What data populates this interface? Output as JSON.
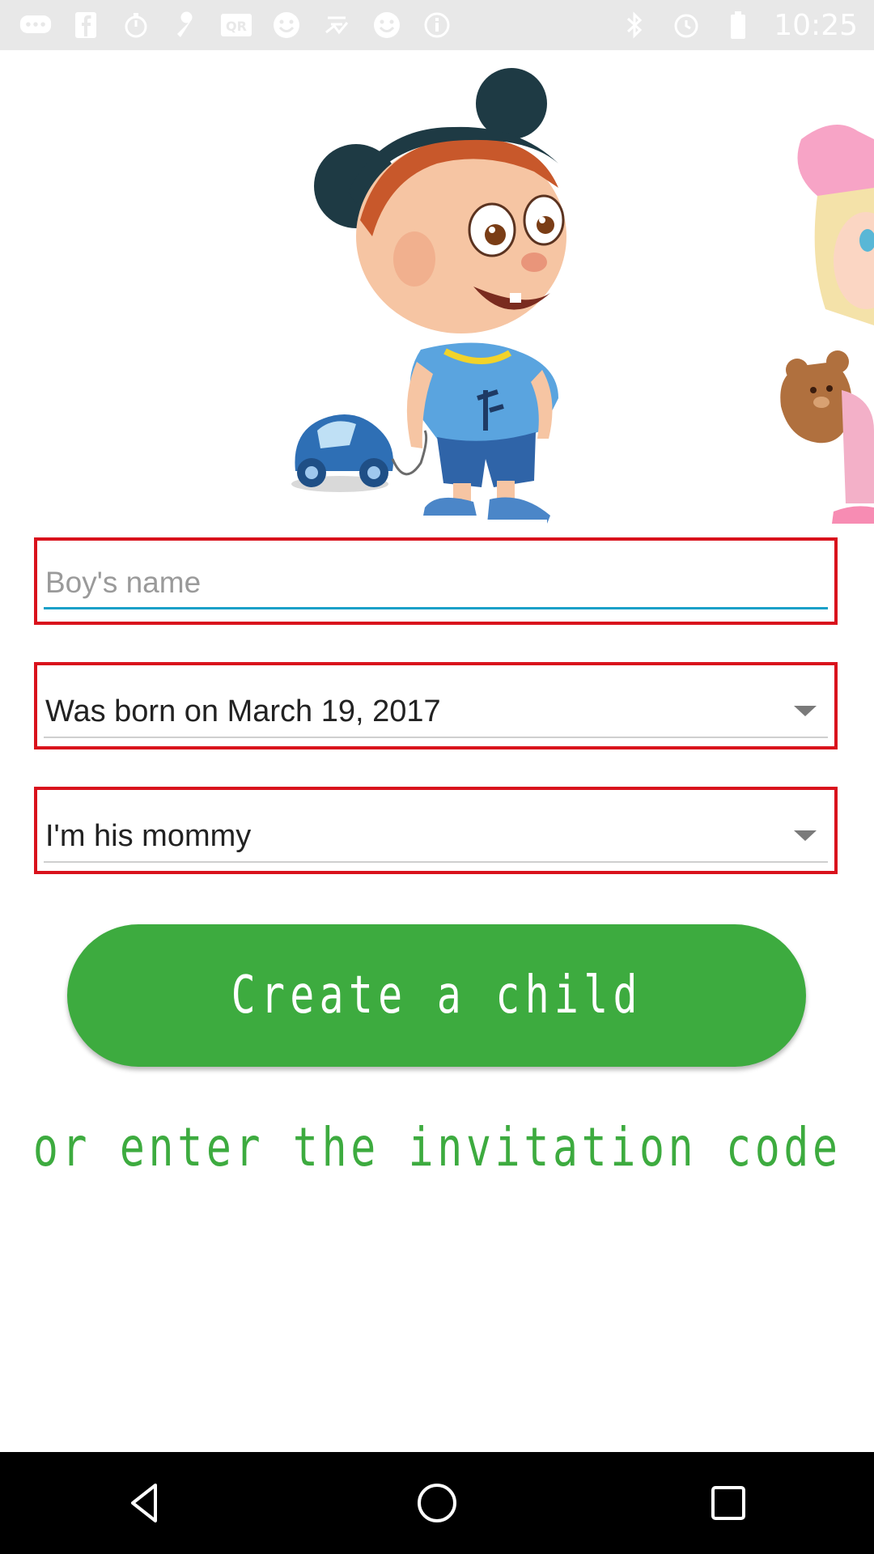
{
  "status_bar": {
    "time": "10:25",
    "left_icons": [
      "chat-icon",
      "facebook-icon",
      "timer-icon",
      "wrench-icon",
      "qr-icon",
      "smiley-icon",
      "app-icon",
      "smiley-icon",
      "info-icon"
    ],
    "right_icons": [
      "bluetooth-icon",
      "alarm-icon",
      "battery-icon"
    ]
  },
  "form": {
    "name_placeholder": "Boy's name",
    "name_value": "",
    "birth_select": "Was born on March 19, 2017",
    "relation_select": "I'm his mommy"
  },
  "actions": {
    "create_label": "Create a child",
    "invite_label": "or enter the invitation code"
  },
  "colors": {
    "accent_green": "#3dab3f",
    "field_border_red": "#d9121c",
    "input_underline": "#1aa0c8"
  },
  "nav_bar": {
    "buttons": [
      "back-icon",
      "home-icon",
      "recents-icon"
    ]
  }
}
